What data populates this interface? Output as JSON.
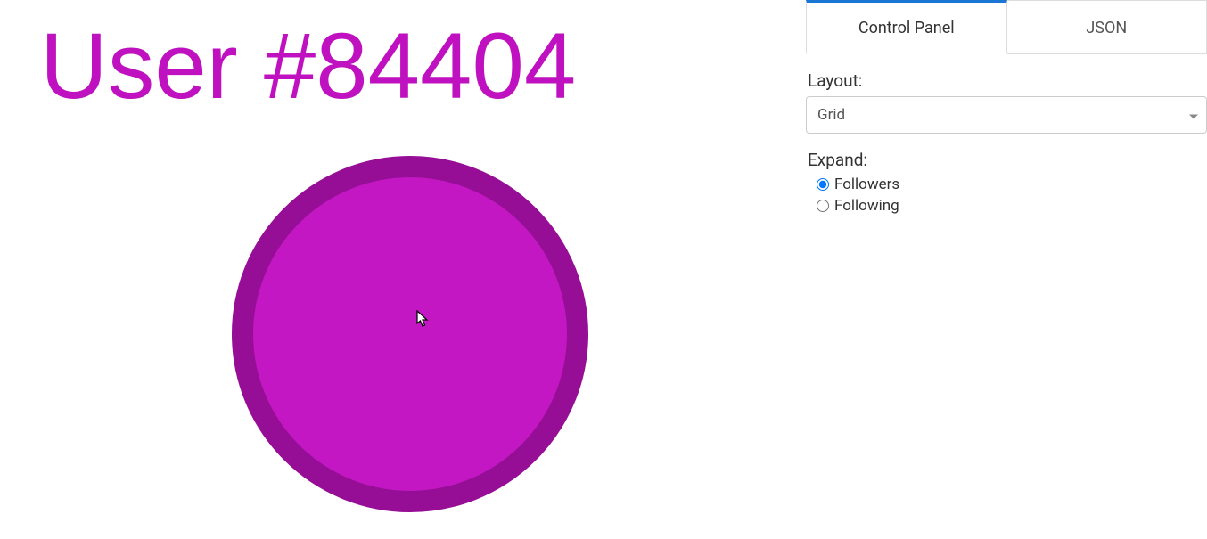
{
  "main": {
    "node_label": "User #84404"
  },
  "panel": {
    "tabs": [
      {
        "label": "Control Panel",
        "active": true
      },
      {
        "label": "JSON",
        "active": false
      }
    ],
    "layout": {
      "label": "Layout:",
      "value": "Grid"
    },
    "expand": {
      "label": "Expand:",
      "options": [
        {
          "label": "Followers",
          "checked": true
        },
        {
          "label": "Following",
          "checked": false
        }
      ]
    }
  },
  "colors": {
    "node_fill": "#c217c2",
    "node_stroke": "#960e96",
    "label_color": "#bf11bf",
    "tab_active_border": "#1976d2"
  }
}
